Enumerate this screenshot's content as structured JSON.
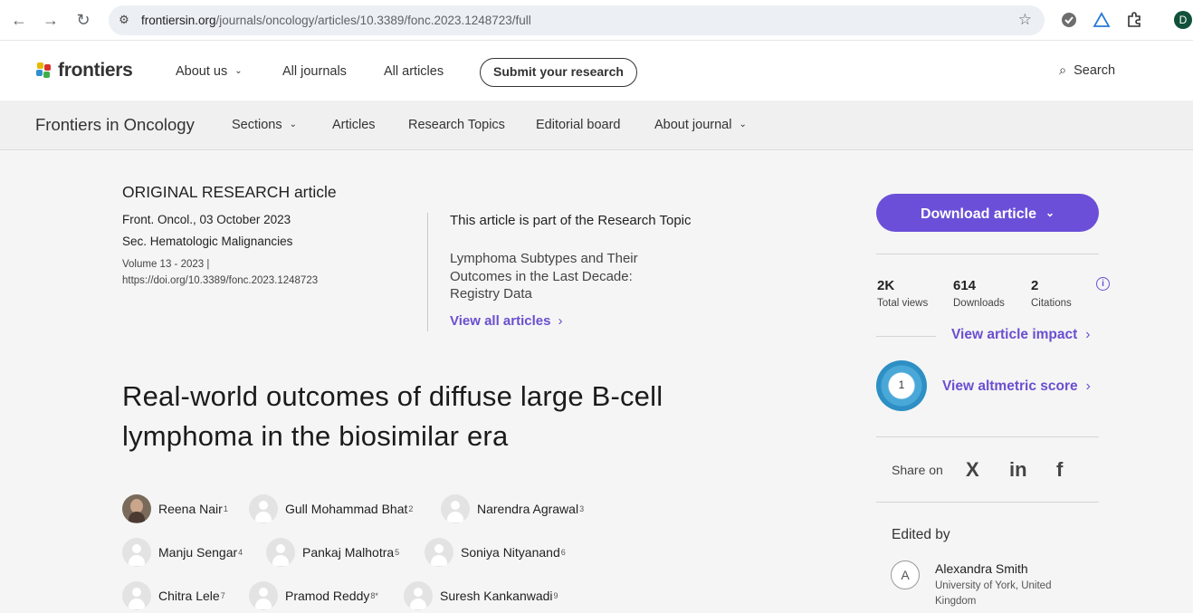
{
  "browser": {
    "url_host": "frontiersin.org",
    "url_path": "/journals/oncology/articles/10.3389/fonc.2023.1248723/full",
    "profile_initial": "D",
    "icons": [
      "back-arrow-icon",
      "forward-arrow-icon",
      "reload-icon",
      "site-info-icon",
      "bookmark-star-icon",
      "extension-icon",
      "puzzle-icon"
    ]
  },
  "site": {
    "logo_text": "frontiers",
    "nav": {
      "about": "About us",
      "journals": "All journals",
      "articles": "All articles",
      "submit": "Submit your research",
      "search": "Search"
    }
  },
  "journal": {
    "name": "Frontiers in Oncology",
    "nav": {
      "sections": "Sections",
      "articles": "Articles",
      "topics": "Research Topics",
      "board": "Editorial board",
      "about": "About journal"
    }
  },
  "article": {
    "type": "ORIGINAL RESEARCH article",
    "citation": "Front. Oncol., 03 October 2023",
    "section": "Sec. Hematologic Malignancies",
    "volume": "Volume 13 - 2023 |",
    "doi": "https://doi.org/10.3389/fonc.2023.1248723",
    "topic_intro": "This article is part of the Research Topic",
    "topic_name": "Lymphoma Subtypes and Their Outcomes in the Last Decade: Registry Data",
    "view_all": "View all articles",
    "title": "Real-world outcomes of diffuse large B-cell lymphoma in the biosimilar era",
    "authors": [
      {
        "name": "Reena Nair",
        "sup": "1"
      },
      {
        "name": "Gull Mohammad Bhat",
        "sup": "2"
      },
      {
        "name": "Narendra Agrawal",
        "sup": "3"
      },
      {
        "name": "Manju Sengar",
        "sup": "4"
      },
      {
        "name": "Pankaj Malhotra",
        "sup": "5"
      },
      {
        "name": "Soniya Nityanand",
        "sup": "6"
      },
      {
        "name": "Chitra Lele",
        "sup": "7"
      },
      {
        "name": "Pramod Reddy",
        "sup": "8*"
      },
      {
        "name": "Suresh Kankanwadi",
        "sup": "9"
      }
    ]
  },
  "sidebar": {
    "download": "Download article",
    "stats": [
      {
        "value": "2K",
        "label": "Total views"
      },
      {
        "value": "614",
        "label": "Downloads"
      },
      {
        "value": "2",
        "label": "Citations"
      }
    ],
    "impact_link": "View article impact",
    "altmetric_score": "1",
    "altmetric_link": "View altmetric score",
    "share_label": "Share on",
    "social": {
      "x": "X",
      "linkedin": "in",
      "facebook": "f"
    },
    "edited_by": "Edited by",
    "editor": {
      "initial": "A",
      "name": "Alexandra Smith",
      "affiliation": "University of York, United Kingdom"
    }
  },
  "colors": {
    "accent": "#6b4fd8",
    "link": "#6a4fd0",
    "altmetric": "#4aa8d8"
  }
}
